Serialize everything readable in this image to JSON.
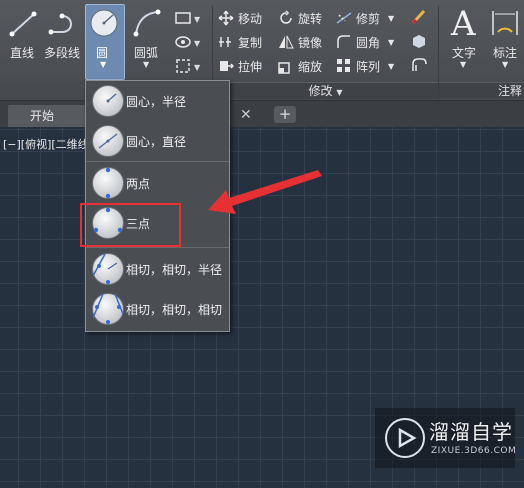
{
  "ribbon": {
    "draw": {
      "line": "直线",
      "polyline": "多段线",
      "circle": "圆",
      "arc": "圆弧"
    },
    "modify": {
      "move": "移动",
      "rotate": "旋转",
      "trim": "修剪",
      "copy": "复制",
      "mirror": "镜像",
      "fillet": "圆角",
      "stretch": "拉伸",
      "scale": "缩放",
      "array": "阵列",
      "panel_title": "修改"
    },
    "annotation": {
      "text": "文字",
      "dimension": "标注",
      "panel_title": "注释"
    }
  },
  "tabs": {
    "start": "开始"
  },
  "viewport_label": "[−][俯视][二维线",
  "circle_menu": {
    "items": [
      {
        "label": "圆心，半径"
      },
      {
        "label": "圆心，直径"
      },
      {
        "label": "两点"
      },
      {
        "label": "三点"
      },
      {
        "label": "相切，相切，半径"
      },
      {
        "label": "相切，相切，相切"
      }
    ],
    "highlighted": "三点"
  },
  "watermark": {
    "name": "溜溜自学",
    "url": "ZIXUE.3D66.COM"
  },
  "colors": {
    "highlight_box": "#e53134",
    "arrow": "#e53134",
    "canvas": "#263140"
  }
}
